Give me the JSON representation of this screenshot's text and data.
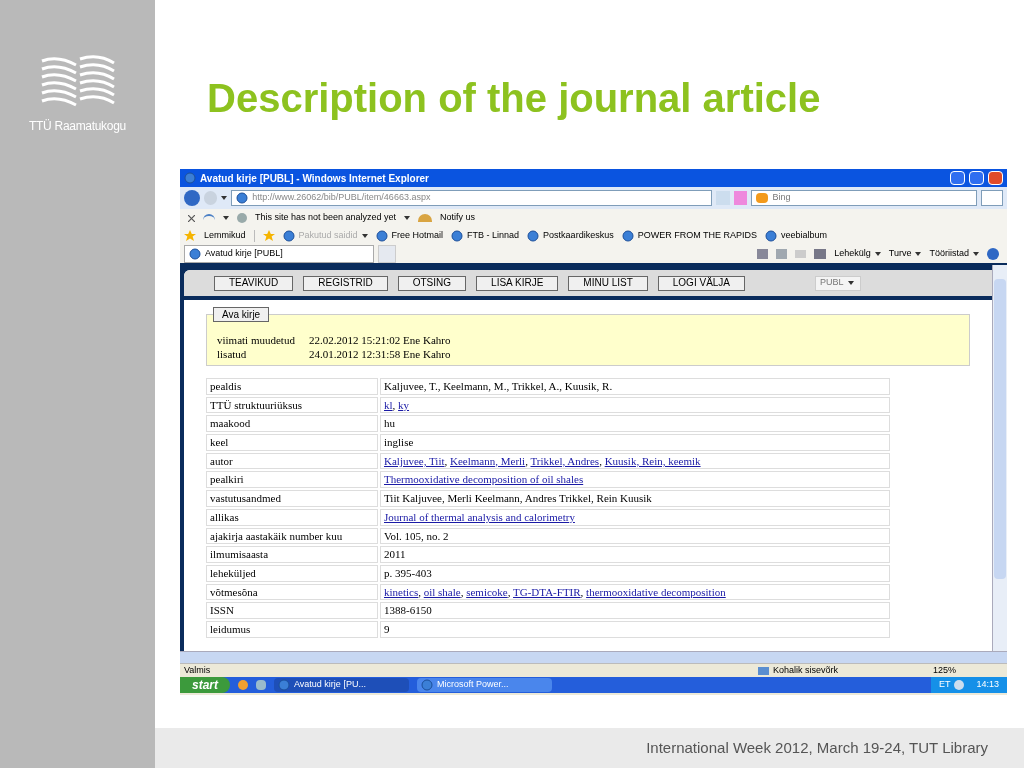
{
  "slide": {
    "logo_text": "TTÜ Raamatukogu",
    "title": "Description of the journal article",
    "footer": "International Week 2012, March 19-24, TUT Library"
  },
  "browser": {
    "title": "Avatud kirje [PUBL] - Windows Internet Explorer",
    "address": "http://www.26062/bib/PUBL/item/46663.aspx",
    "search_placeholder": "Bing",
    "security_text": "This site has not been analyzed yet",
    "notify": "Notify us",
    "favorites_label": "Lemmikud",
    "favorites": [
      {
        "text": "Pakutud saidid",
        "disabled": true
      },
      {
        "text": "Free Hotmail",
        "disabled": false
      },
      {
        "text": "FTB - Linnad",
        "disabled": false
      },
      {
        "text": "Postkaardikeskus",
        "disabled": false
      },
      {
        "text": "POWER FROM THE RAPIDS",
        "disabled": false
      },
      {
        "text": "veebialbum",
        "disabled": false
      }
    ],
    "tab": "Avatud kirje [PUBL]",
    "commands": [
      "Lehekülg",
      "Turve",
      "Tööriistad"
    ],
    "status": "Valmis",
    "zone": "Kohalik sisevõrk",
    "zoom": "125%"
  },
  "page": {
    "nav": [
      "TEAVIKUD",
      "REGISTRID",
      "OTSING",
      "LISA KIRJE",
      "MINU LIST",
      "LOGI VÄLJA"
    ],
    "db_select": {
      "value": "PUBL",
      "disabled": true
    },
    "legend": "Ava kirje",
    "meta": [
      {
        "label": "viimati muudetud",
        "value": "22.02.2012 15:21:02 Ene Kahro"
      },
      {
        "label": "lisatud",
        "value": "24.01.2012 12:31:58 Ene Kahro"
      }
    ],
    "rows": [
      {
        "label": "pealdis",
        "parts": [
          {
            "text": "Kaljuvee, T., Keelmann, M., Trikkel, A., Kuusik, R.",
            "link": false
          }
        ]
      },
      {
        "label": "TTÜ struktuuriüksus",
        "parts": [
          {
            "text": "kl",
            "link": true
          },
          {
            "text": ", ",
            "link": false
          },
          {
            "text": "ky",
            "link": true
          }
        ]
      },
      {
        "label": "maakood",
        "parts": [
          {
            "text": "hu",
            "link": false
          }
        ]
      },
      {
        "label": "keel",
        "parts": [
          {
            "text": "inglise",
            "link": false
          }
        ]
      },
      {
        "label": "autor",
        "parts": [
          {
            "text": "Kaljuvee, Tiit",
            "link": true
          },
          {
            "text": ", ",
            "link": false
          },
          {
            "text": "Keelmann, Merli",
            "link": true
          },
          {
            "text": ", ",
            "link": false
          },
          {
            "text": "Trikkel, Andres",
            "link": true
          },
          {
            "text": ", ",
            "link": false
          },
          {
            "text": "Kuusik, Rein, keemik",
            "link": true
          }
        ]
      },
      {
        "label": "pealkiri",
        "parts": [
          {
            "text": "Thermooxidative decomposition of oil shales",
            "link": true
          }
        ]
      },
      {
        "label": "vastutusandmed",
        "parts": [
          {
            "text": "Tiit Kaljuvee, Merli Keelmann, Andres Trikkel, Rein Kuusik",
            "link": false
          }
        ]
      },
      {
        "label": "allikas",
        "parts": [
          {
            "text": "Journal of thermal analysis and calorimetry",
            "link": true
          }
        ]
      },
      {
        "label": "ajakirja aastakäik number kuu",
        "parts": [
          {
            "text": "Vol. 105, no. 2",
            "link": false
          }
        ]
      },
      {
        "label": "ilmumisaasta",
        "parts": [
          {
            "text": "2011",
            "link": false
          }
        ]
      },
      {
        "label": "leheküljed",
        "parts": [
          {
            "text": "p. 395-403",
            "link": false
          }
        ]
      },
      {
        "label": "võtmesõna",
        "parts": [
          {
            "text": "kinetics",
            "link": true
          },
          {
            "text": ", ",
            "link": false
          },
          {
            "text": "oil shale",
            "link": true
          },
          {
            "text": ", ",
            "link": false
          },
          {
            "text": "semicoke",
            "link": true
          },
          {
            "text": ", ",
            "link": false
          },
          {
            "text": "TG-DTA-FTIR",
            "link": true
          },
          {
            "text": ", ",
            "link": false
          },
          {
            "text": "thermooxidative decomposition",
            "link": true
          }
        ]
      },
      {
        "label": "ISSN",
        "parts": [
          {
            "text": "1388-6150",
            "link": false
          }
        ]
      },
      {
        "label": "leidumus",
        "parts": [
          {
            "text": "9",
            "link": false
          }
        ]
      }
    ]
  },
  "taskbar": {
    "start": "start",
    "tasks": [
      {
        "label": "Avatud kirje [PU...",
        "selected": false
      },
      {
        "label": "Microsoft Power...",
        "selected": true
      }
    ],
    "lang": "ET",
    "clock": "14:13"
  }
}
